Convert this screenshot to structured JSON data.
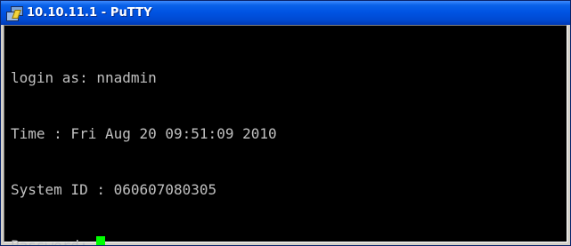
{
  "window": {
    "title": "10.10.11.1 - PuTTY",
    "icon": "putty-icon"
  },
  "terminal": {
    "lines": [
      "login as: nnadmin",
      "Time : Fri Aug 20 09:51:09 2010",
      "System ID : 060607080305",
      "Password: "
    ],
    "foreground": "#c0c0c0",
    "background": "#000000",
    "cursor_color": "#00ff00"
  }
}
